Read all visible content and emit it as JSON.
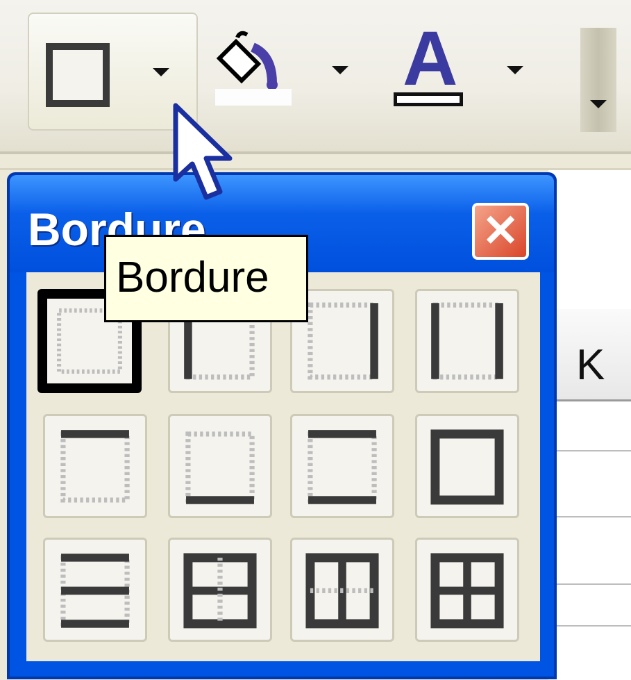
{
  "toolbar": {
    "buttons": [
      {
        "name": "borders",
        "icon": "border-square-icon"
      },
      {
        "name": "fill-color",
        "icon": "paint-bucket-icon"
      },
      {
        "name": "font-color",
        "icon": "font-color-icon",
        "letter": "A"
      },
      {
        "name": "toolbar-options",
        "icon": "chevron-down-icon"
      }
    ]
  },
  "palette": {
    "title": "Bordure",
    "close_icon": "close-icon",
    "border_options": [
      "no-border",
      "left-border",
      "right-border",
      "left-right-border",
      "top-border",
      "bottom-border",
      "top-bottom-border",
      "outside-borders",
      "inner-horizontal-borders",
      "inner-borders-outline",
      "inner-vertical-borders",
      "all-borders"
    ]
  },
  "tooltip": {
    "text": "Bordure"
  },
  "sheet": {
    "column_header": "K"
  },
  "colors": {
    "titlebar": "#0054e3",
    "tooltip_bg": "#ffffe1",
    "close_button": "#d9452a",
    "font_color": "#3b3aa0"
  }
}
